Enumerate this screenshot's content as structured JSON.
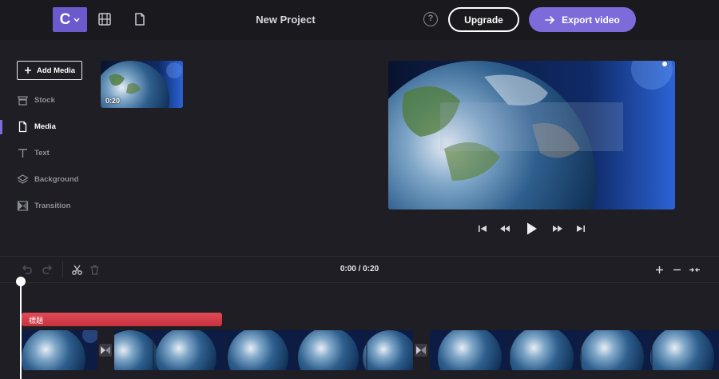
{
  "header": {
    "logo_letter": "C",
    "project_title": "New Project",
    "help_label": "?",
    "upgrade_label": "Upgrade",
    "export_label": "Export video"
  },
  "sidebar": {
    "add_media_label": "Add Media",
    "items": [
      {
        "label": "Stock",
        "icon": "stock-icon"
      },
      {
        "label": "Media",
        "icon": "file-icon",
        "active": true
      },
      {
        "label": "Text",
        "icon": "text-icon"
      },
      {
        "label": "Background",
        "icon": "layers-icon"
      },
      {
        "label": "Transition",
        "icon": "transition-icon"
      }
    ]
  },
  "media_library": {
    "items": [
      {
        "duration": "0:20"
      }
    ]
  },
  "timeline": {
    "time_code": "0:00 / 0:20",
    "text_clip_label": "標題"
  },
  "colors": {
    "accent": "#7c6bd8",
    "logo": "#6a5acd",
    "text_clip": "#d63d49",
    "background": "#1e1e24",
    "topbar": "#19191e"
  }
}
